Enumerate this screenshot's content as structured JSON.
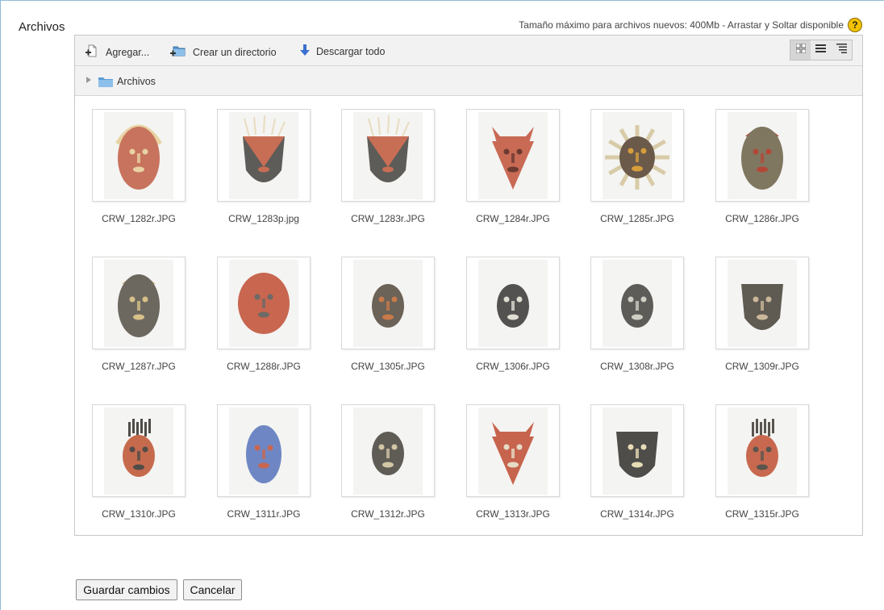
{
  "field": {
    "label": "Archivos",
    "max_info": "Tamaño máximo para archivos nuevos: 400Mb - Arrastar y Soltar disponible"
  },
  "toolbar": {
    "add_label": "Agregar...",
    "mkdir_label": "Crear un directorio",
    "download_label": "Descargar todo"
  },
  "path": {
    "root": "Archivos"
  },
  "files": [
    {
      "name": "CRW_1282r.JPG",
      "face": "#c8735e",
      "accent": "#e8d3a3",
      "style": "hair"
    },
    {
      "name": "CRW_1283p.jpg",
      "face": "#5d5c58",
      "accent": "#c76e55",
      "style": "fringe"
    },
    {
      "name": "CRW_1283r.JPG",
      "face": "#5d5c58",
      "accent": "#c76e55",
      "style": "fringe"
    },
    {
      "name": "CRW_1284r.JPG",
      "face": "#c96a55",
      "accent": "#6b3a30",
      "style": "ears"
    },
    {
      "name": "CRW_1285r.JPG",
      "face": "#6b5a4a",
      "accent": "#d79e3c",
      "style": "sun"
    },
    {
      "name": "CRW_1286r.JPG",
      "face": "#807761",
      "accent": "#b34736",
      "style": "crown"
    },
    {
      "name": "CRW_1287r.JPG",
      "face": "#6c6860",
      "accent": "#d7c08a",
      "style": "crown"
    },
    {
      "name": "CRW_1288r.JPG",
      "face": "#c86650",
      "accent": "#6c6a66",
      "style": "round"
    },
    {
      "name": "CRW_1305r.JPG",
      "face": "#6b6258",
      "accent": "#c77a4a",
      "style": "small"
    },
    {
      "name": "CRW_1306r.JPG",
      "face": "#545250",
      "accent": "#e0ddd2",
      "style": "small"
    },
    {
      "name": "CRW_1308r.JPG",
      "face": "#5e5c58",
      "accent": "#cfcfc5",
      "style": "small"
    },
    {
      "name": "CRW_1309r.JPG",
      "face": "#5f5a52",
      "accent": "#cbb89a",
      "style": "shield"
    },
    {
      "name": "CRW_1310r.JPG",
      "face": "#c66a4d",
      "accent": "#4f4c48",
      "style": "spikes"
    },
    {
      "name": "CRW_1311r.JPG",
      "face": "#6e87c4",
      "accent": "#c86650",
      "style": "oval"
    },
    {
      "name": "CRW_1312r.JPG",
      "face": "#5f5c56",
      "accent": "#d2c6a4",
      "style": "small"
    },
    {
      "name": "CRW_1313r.JPG",
      "face": "#c7644e",
      "accent": "#e6dcc6",
      "style": "ears"
    },
    {
      "name": "CRW_1314r.JPG",
      "face": "#4e4d4a",
      "accent": "#e8dcb6",
      "style": "shield"
    },
    {
      "name": "CRW_1315r.JPG",
      "face": "#c8694f",
      "accent": "#5a554e",
      "style": "spikes"
    }
  ],
  "buttons": {
    "save": "Guardar cambios",
    "cancel": "Cancelar"
  }
}
